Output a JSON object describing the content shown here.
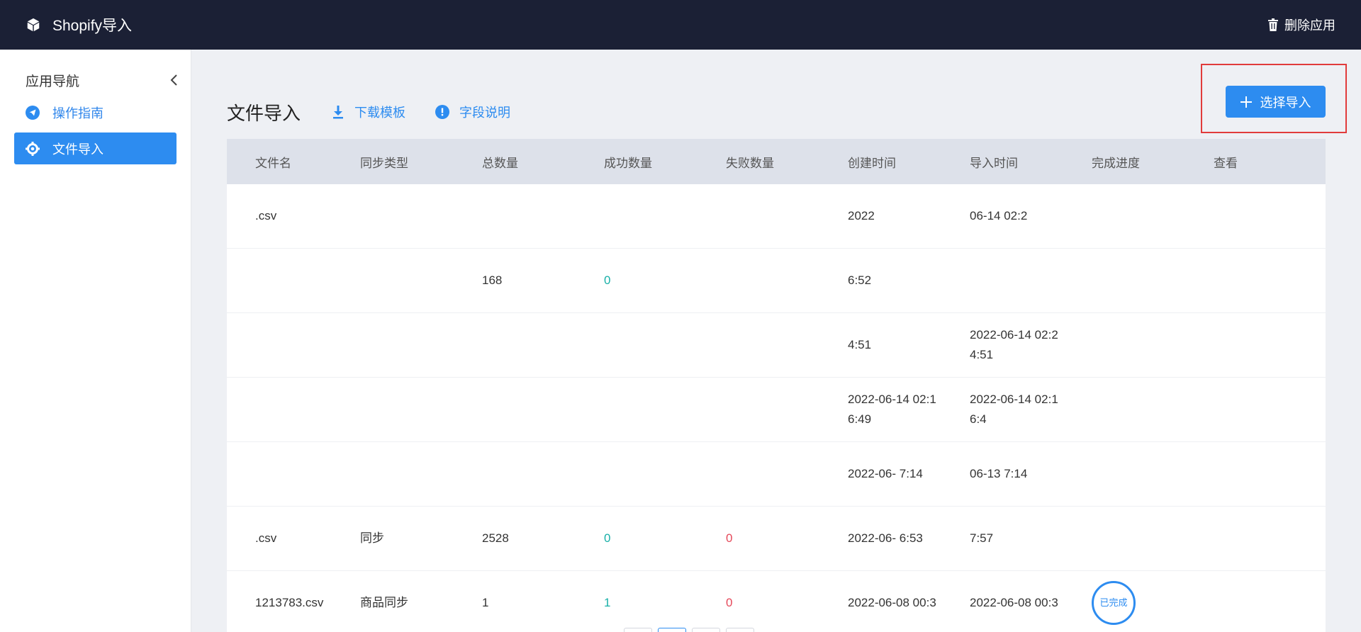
{
  "topbar": {
    "app_title": "Shopify导入",
    "delete_label": "删除应用",
    "background": "#1b2035"
  },
  "sidebar": {
    "title": "应用导航",
    "items": [
      {
        "label": "操作指南",
        "icon": "navigation-arrow-icon",
        "active": false
      },
      {
        "label": "文件导入",
        "icon": "gear-icon",
        "active": true
      }
    ]
  },
  "page": {
    "title": "文件导入",
    "download_label": "下载模板",
    "fields_label": "字段说明",
    "import_button_label": "选择导入"
  },
  "table": {
    "headers": [
      "文件名",
      "同步类型",
      "总数量",
      "成功数量",
      "失败数量",
      "创建时间",
      "导入时间",
      "完成进度",
      "查看"
    ],
    "rows": [
      {
        "file": ".csv",
        "type": "",
        "total": "",
        "ok": "",
        "fail": "",
        "created": "2022",
        "imported": "06-14 02:2",
        "progress": "",
        "view": ""
      },
      {
        "file": "",
        "type": "",
        "total": "168",
        "ok": "0",
        "fail": "",
        "created": "6:52",
        "imported": "",
        "progress": "",
        "view": ""
      },
      {
        "file": "",
        "type": "",
        "total": "",
        "ok": "",
        "fail": "",
        "created": "4:51",
        "imported": "2022-06-14 02:2 4:51",
        "progress": "",
        "view": ""
      },
      {
        "file": "",
        "type": "",
        "total": "",
        "ok": "",
        "fail": "",
        "created": "2022-06-14 02:1 6:49",
        "imported": "2022-06-14 02:1 6:4",
        "progress": "",
        "view": ""
      },
      {
        "file": "",
        "type": "",
        "total": "",
        "ok": "",
        "fail": "",
        "created": "2022-06- 7:14",
        "imported": "06-13 7:14",
        "progress": "",
        "view": ""
      },
      {
        "file": ".csv",
        "type": "同步",
        "total": "2528",
        "ok": "0",
        "fail": "0",
        "created": "2022-06- 6:53",
        "imported": "7:57",
        "progress": "",
        "view": ""
      },
      {
        "file": "1213783.csv",
        "type": "商品同步",
        "total": "1",
        "ok": "1",
        "fail": "0",
        "created": "2022-06-08 00:3",
        "imported": "2022-06-08 00:3",
        "progress": "已完成",
        "view": ""
      }
    ]
  },
  "colors": {
    "accent": "#2d8cf0",
    "success": "#19b0a8",
    "danger": "#e5495a",
    "highlight": "#e13b3b"
  }
}
